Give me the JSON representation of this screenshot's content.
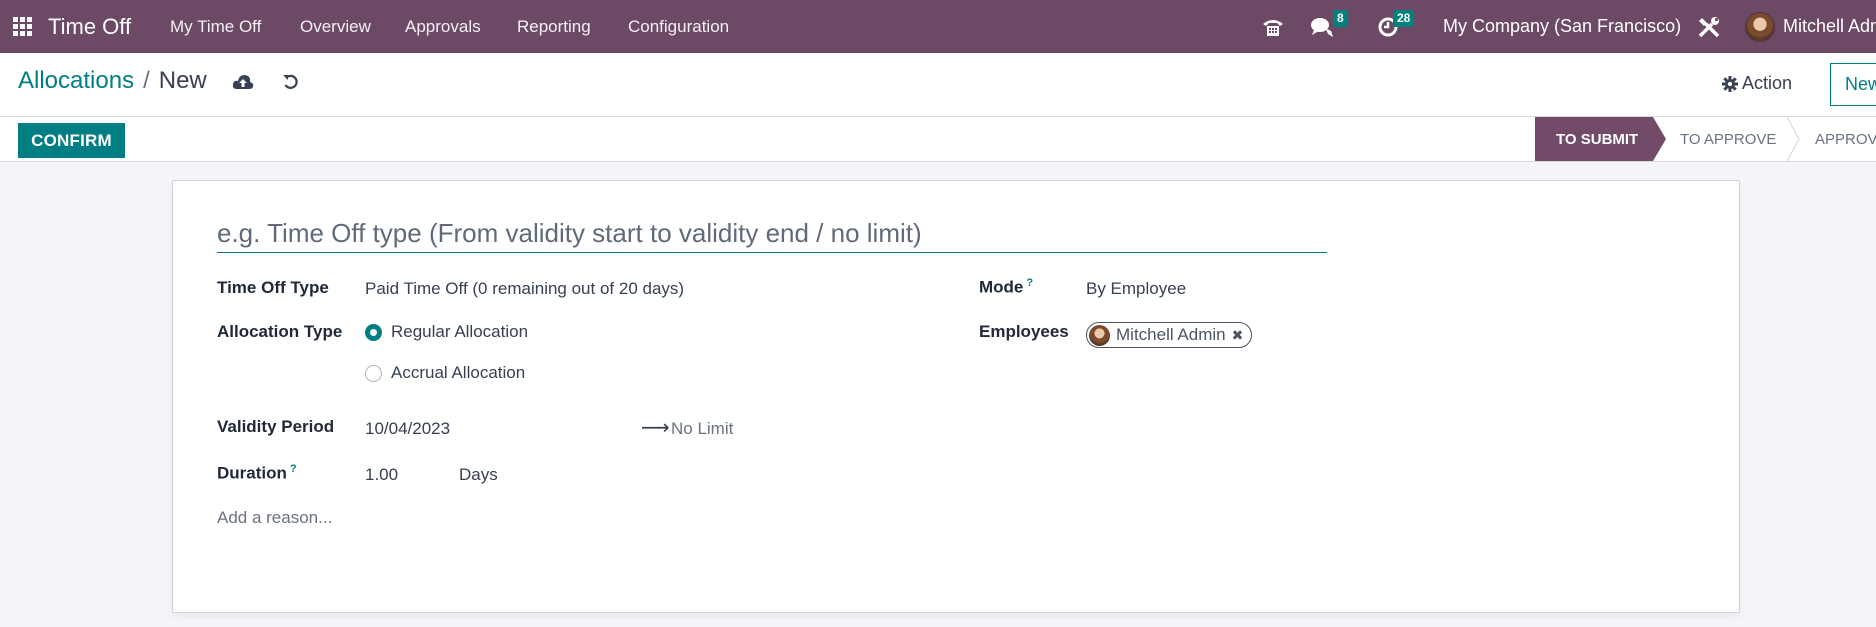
{
  "navbar": {
    "app_name": "Time Off",
    "menu": [
      "My Time Off",
      "Overview",
      "Approvals",
      "Reporting",
      "Configuration"
    ],
    "messages_badge": "8",
    "activities_badge": "28",
    "company": "My Company (San Francisco)",
    "user": "Mitchell Admin"
  },
  "control": {
    "breadcrumb_parent": "Allocations",
    "breadcrumb_sep": "/",
    "breadcrumb_current": "New",
    "action_label": "Action",
    "new_label": "New"
  },
  "statusbar": {
    "confirm_label": "CONFIRM",
    "stages": [
      "TO SUBMIT",
      "TO APPROVE",
      "APPROVED"
    ],
    "active_stage": "TO SUBMIT"
  },
  "form": {
    "title_placeholder": "e.g. Time Off type (From validity start to validity end / no limit)",
    "time_off_type_label": "Time Off Type",
    "time_off_type_value": "Paid Time Off (0 remaining out of 20 days)",
    "allocation_type_label": "Allocation Type",
    "allocation_options": [
      "Regular Allocation",
      "Accrual Allocation"
    ],
    "allocation_selected": "Regular Allocation",
    "validity_label": "Validity Period",
    "validity_start": "10/04/2023",
    "validity_end": "No Limit",
    "duration_label": "Duration",
    "duration_value": "1.00",
    "duration_unit": "Days",
    "reason_placeholder": "Add a reason...",
    "mode_label": "Mode",
    "mode_value": "By Employee",
    "employees_label": "Employees",
    "employees": [
      "Mitchell Admin"
    ],
    "help_marker": "?"
  }
}
